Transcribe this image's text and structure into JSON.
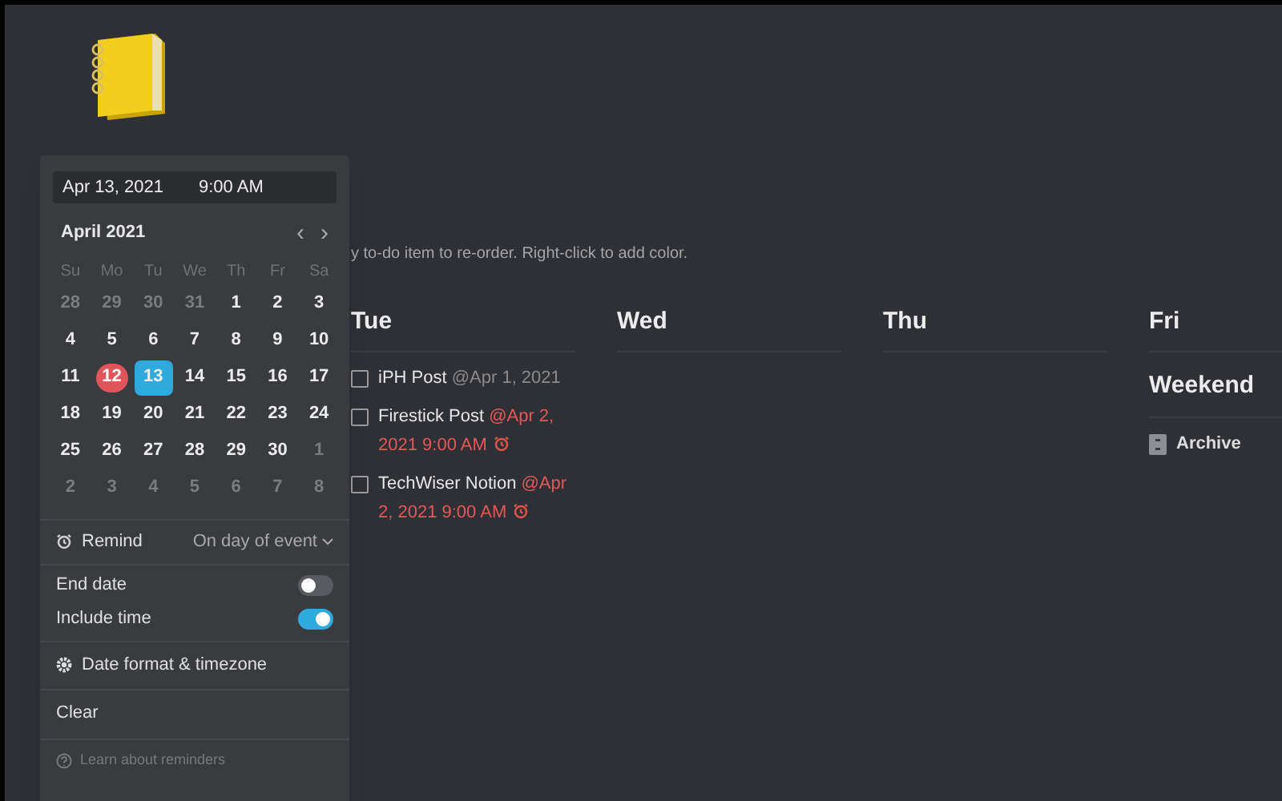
{
  "board": {
    "hint": "y to-do item to re-order. Right-click to add color.",
    "columns": [
      {
        "title": "Tue",
        "sections": [
          {
            "items": [
              {
                "kind": "todo",
                "title": "iPH Post",
                "date": "@Apr 1, 2021",
                "reminder": false,
                "checked": false
              },
              {
                "kind": "todo",
                "title": "Firestick Post",
                "date": "@Apr 2, 2021 9:00 AM",
                "reminder": true,
                "checked": false
              },
              {
                "kind": "todo",
                "title": "TechWiser Notion",
                "date": "@Apr 2, 2021 9:00 AM",
                "reminder": true,
                "checked": false
              }
            ]
          }
        ]
      },
      {
        "title": "Wed"
      },
      {
        "title": "Thu"
      },
      {
        "title": "Fri",
        "sections": [
          {
            "heading": "Weekend",
            "items": [
              {
                "kind": "page",
                "title": "Archive"
              }
            ]
          }
        ]
      }
    ]
  },
  "date_picker": {
    "date_value": "Apr 13, 2021",
    "time_value": "9:00 AM",
    "month": "April 2021",
    "prev": "‹",
    "next": "›",
    "weekdays": [
      "Su",
      "Mo",
      "Tu",
      "We",
      "Th",
      "Fr",
      "Sa"
    ],
    "days": [
      {
        "label": "28",
        "kind": "outside",
        "selected": false
      },
      {
        "label": "29",
        "kind": "outside",
        "selected": false
      },
      {
        "label": "30",
        "kind": "outside",
        "selected": false
      },
      {
        "label": "31",
        "kind": "outside",
        "selected": false
      },
      {
        "label": "1",
        "kind": "current",
        "selected": false
      },
      {
        "label": "2",
        "kind": "current",
        "selected": false
      },
      {
        "label": "3",
        "kind": "current",
        "selected": false
      },
      {
        "label": "4",
        "kind": "current",
        "selected": false
      },
      {
        "label": "5",
        "kind": "current",
        "selected": false
      },
      {
        "label": "6",
        "kind": "current",
        "selected": false
      },
      {
        "label": "7",
        "kind": "current",
        "selected": false
      },
      {
        "label": "8",
        "kind": "current",
        "selected": false
      },
      {
        "label": "9",
        "kind": "current",
        "selected": false
      },
      {
        "label": "10",
        "kind": "current",
        "selected": false
      },
      {
        "label": "11",
        "kind": "current",
        "selected": false
      },
      {
        "label": "12",
        "kind": "today",
        "selected": false
      },
      {
        "label": "13",
        "kind": "current",
        "selected": true
      },
      {
        "label": "14",
        "kind": "current",
        "selected": false
      },
      {
        "label": "15",
        "kind": "current",
        "selected": false
      },
      {
        "label": "16",
        "kind": "current",
        "selected": false
      },
      {
        "label": "17",
        "kind": "current",
        "selected": false
      },
      {
        "label": "18",
        "kind": "current",
        "selected": false
      },
      {
        "label": "19",
        "kind": "current",
        "selected": false
      },
      {
        "label": "20",
        "kind": "current",
        "selected": false
      },
      {
        "label": "21",
        "kind": "current",
        "selected": false
      },
      {
        "label": "22",
        "kind": "current",
        "selected": false
      },
      {
        "label": "23",
        "kind": "current",
        "selected": false
      },
      {
        "label": "24",
        "kind": "current",
        "selected": false
      },
      {
        "label": "25",
        "kind": "current",
        "selected": false
      },
      {
        "label": "26",
        "kind": "current",
        "selected": false
      },
      {
        "label": "27",
        "kind": "current",
        "selected": false
      },
      {
        "label": "28",
        "kind": "current",
        "selected": false
      },
      {
        "label": "29",
        "kind": "current",
        "selected": false
      },
      {
        "label": "30",
        "kind": "current",
        "selected": false
      },
      {
        "label": "1",
        "kind": "outside",
        "selected": false
      },
      {
        "label": "2",
        "kind": "outside",
        "selected": false
      },
      {
        "label": "3",
        "kind": "outside",
        "selected": false
      },
      {
        "label": "4",
        "kind": "outside",
        "selected": false
      },
      {
        "label": "5",
        "kind": "outside",
        "selected": false
      },
      {
        "label": "6",
        "kind": "outside",
        "selected": false
      },
      {
        "label": "7",
        "kind": "outside",
        "selected": false
      },
      {
        "label": "8",
        "kind": "outside",
        "selected": false
      }
    ],
    "remind": {
      "label": "Remind",
      "value": "On day of event"
    },
    "toggles": [
      {
        "label": "End date",
        "on": false
      },
      {
        "label": "Include time",
        "on": true
      }
    ],
    "format_label": "Date format & timezone",
    "clear_label": "Clear",
    "help_label": "Learn about reminders"
  }
}
